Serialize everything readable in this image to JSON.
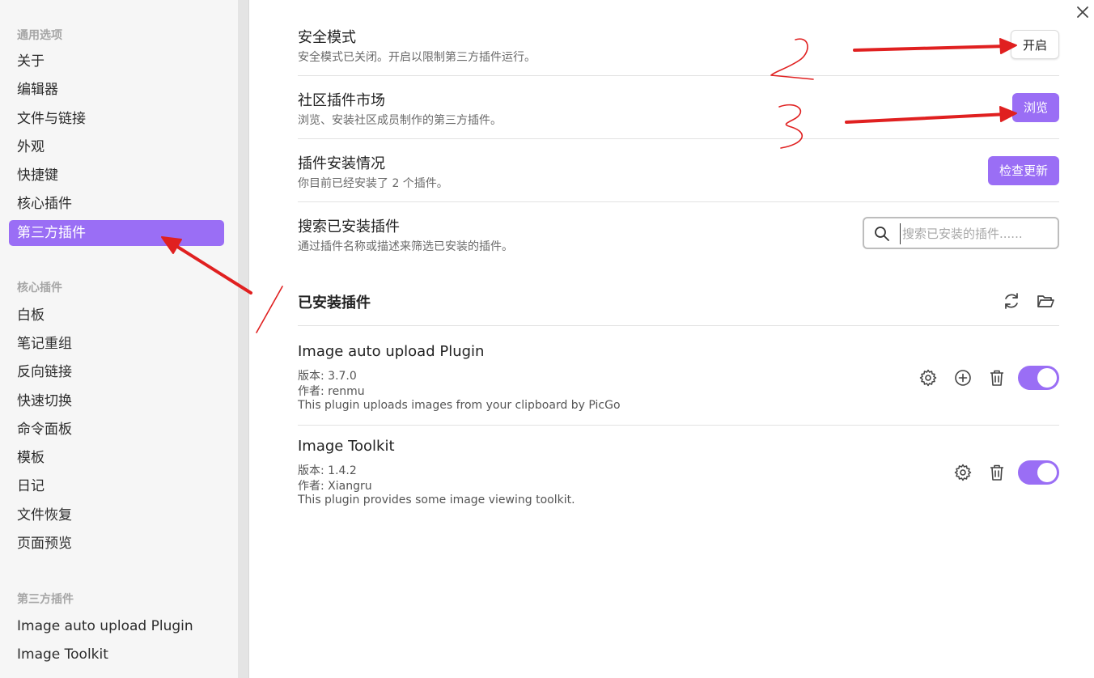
{
  "sidebar": {
    "groups": [
      {
        "heading": "通用选项",
        "items": [
          "关于",
          "编辑器",
          "文件与链接",
          "外观",
          "快捷键",
          "核心插件",
          "第三方插件"
        ]
      },
      {
        "heading": "核心插件",
        "items": [
          "白板",
          "笔记重组",
          "反向链接",
          "快速切换",
          "命令面板",
          "模板",
          "日记",
          "文件恢复",
          "页面预览"
        ]
      },
      {
        "heading": "第三方插件",
        "items": [
          "Image auto upload Plugin",
          "Image Toolkit"
        ]
      }
    ],
    "active_item": "第三方插件"
  },
  "settings": {
    "safe_mode": {
      "title": "安全模式",
      "desc": "安全模式已关闭。开启以限制第三方插件运行。",
      "button": "开启"
    },
    "community": {
      "title": "社区插件市场",
      "desc": "浏览、安装社区成员制作的第三方插件。",
      "button": "浏览"
    },
    "installed_status": {
      "title": "插件安装情况",
      "desc": "你目前已经安装了 2 个插件。",
      "button": "检查更新"
    },
    "search": {
      "title": "搜索已安装插件",
      "desc": "通过插件名称或描述来筛选已安装的插件。",
      "placeholder": "搜索已安装的插件......"
    }
  },
  "installed": {
    "heading": "已安装插件",
    "plugins": [
      {
        "name": "Image auto upload Plugin",
        "version_label": "版本: 3.7.0",
        "author_label": "作者:  renmu",
        "description": "This plugin uploads images from your clipboard by PicGo",
        "enabled": true,
        "icons": [
          "gear-icon",
          "plus-circle-icon",
          "trash-icon"
        ]
      },
      {
        "name": "Image Toolkit",
        "version_label": "版本: 1.4.2",
        "author_label": "作者:  Xiangru",
        "description": "This plugin provides some image viewing toolkit.",
        "enabled": true,
        "icons": [
          "gear-icon",
          "trash-icon"
        ]
      }
    ]
  },
  "colors": {
    "accent": "#9a6ef5",
    "annotation_red": "#e02020"
  }
}
